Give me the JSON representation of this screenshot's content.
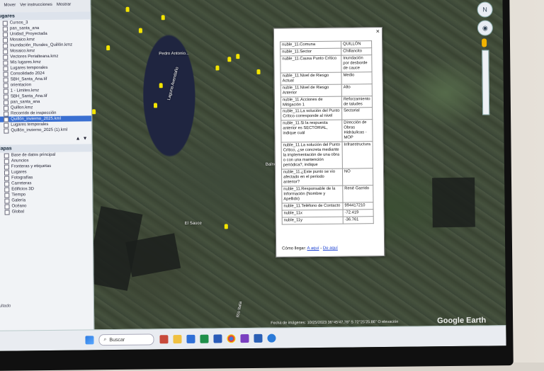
{
  "left_panel": {
    "top_links": [
      "Mover",
      "Ver instrucciones",
      "Mostrar"
    ],
    "places_header": "Lugares",
    "places": [
      "Cursos_3",
      "pan_santa_ana",
      "Unidad_Proyectada",
      "Mosaico.kmz",
      "Inundación_Rurales_Quillón.kmz",
      "Mosaico.kmz",
      "Vectores Perialteana.kmz",
      "Mis lugares.kmz",
      "Lugares temporales",
      "Consolidado 2024",
      "SBH_Santa_Ana.tif",
      "orientacion",
      "1 - Limites.kmz",
      "SBH_Santa_Ana.tif",
      "pan_santa_ana",
      "Quillon.kmz",
      "Recorrido de inspección",
      "Quillón_invierno_2025.kml",
      "Lugares temporales",
      "Quillón_invierno_2025 (1).kml"
    ],
    "selected_index": 17,
    "layers_header": "Capas",
    "layers": [
      "Base de datos principal",
      "Anuncios",
      "Fronteras y etiquetas",
      "Lugares",
      "Fotografías",
      "Carreteras",
      "Edificios 3D",
      "Tiempo",
      "Galería",
      "Océano",
      "Global"
    ],
    "status_text": "multado"
  },
  "popup": {
    "close_label": "×",
    "rows": [
      {
        "k": "nuble_11.Comuna",
        "v": "QUILLÓN"
      },
      {
        "k": "nuble_11.Sector",
        "v": "Chillancito"
      },
      {
        "k": "nuble_11.Causa Punto Crítico",
        "v": "Inundación por desborde de cauce"
      },
      {
        "k": "nuble_11.Nivel de Riesgo Actual",
        "v": "Medio"
      },
      {
        "k": "nuble_11.Nivel de Riesgo Anterior",
        "v": "Alto"
      },
      {
        "k": "nuble_11.Acciones de Mitigación 1",
        "v": "Reforzamiento de taludes"
      },
      {
        "k": "nuble_11.La solución del Punto Crítico corresponde al nivel",
        "v": "Sectorial"
      },
      {
        "k": "nuble_11.Si la respuesta anterior es SECTORIAL, indique cuál",
        "v": "Dirección de Obras Hidráulicas - MOP"
      },
      {
        "k": "nuble_11.La solución del Punto Crítico, ¿se concreta mediante la implementación de una obra o con una mantención periódica?, indique",
        "v": "Infraestructura"
      },
      {
        "k": "nuble_11.¿Este punto se vio afectado en el período anterior?",
        "v": "NO"
      },
      {
        "k": "nuble_11.Responsable de la Información (Nombre y Apellido)",
        "v": "René Garrido"
      },
      {
        "k": "nuble_11.Teléfono de Contacto",
        "v": "994417210"
      },
      {
        "k": "nuble_11x",
        "v": "-72.419"
      },
      {
        "k": "nuble_11y",
        "v": "-36.761"
      }
    ],
    "link_prefix": "Cómo llegar:",
    "link_here": "A aquí",
    "link_sep": "-",
    "link_from": "De aquí"
  },
  "map": {
    "labels": [
      "Laguna Avendaño",
      "Balneario las...",
      "Pedro Antonio...",
      "El Sauce",
      "Río Itata"
    ],
    "status_bar": "Fecha de imágenes: 10/25/2023   36°45'47.78\" S   72°25'25.86\" O   elevación",
    "brand": "Google Earth"
  },
  "taskbar": {
    "search_label": "Buscar"
  },
  "colors": {
    "pin": "#f3e400",
    "selection": "#3a6fd1"
  }
}
